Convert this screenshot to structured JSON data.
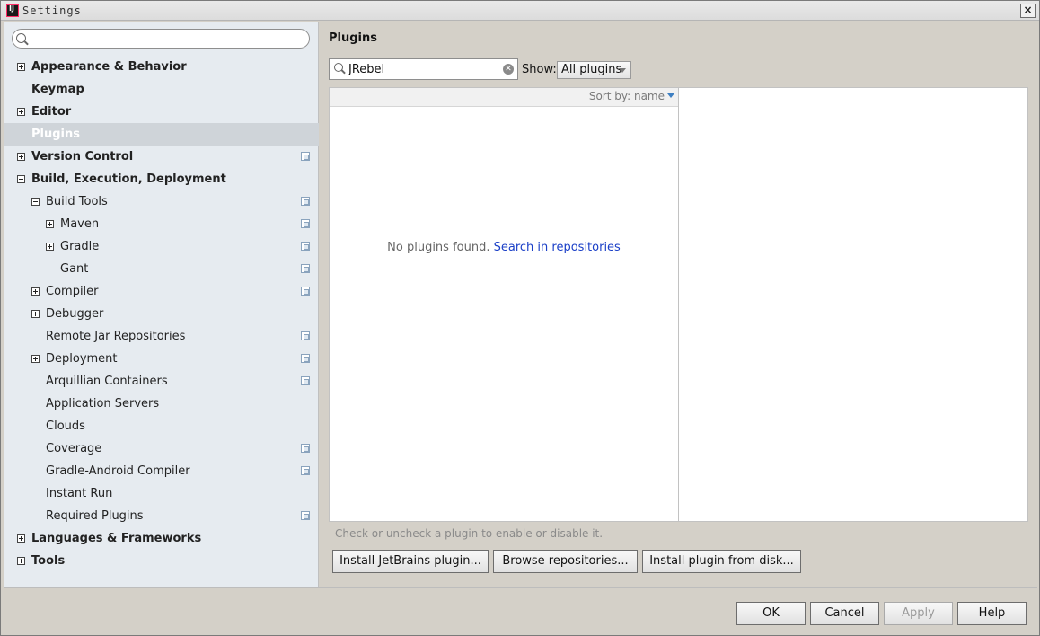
{
  "window": {
    "title": "Settings",
    "close_glyph": "×"
  },
  "sidebar": {
    "search_placeholder": "",
    "tree": [
      {
        "label": "Appearance & Behavior",
        "level": 0,
        "expander": "plus",
        "bold": true,
        "project_icon": false
      },
      {
        "label": "Keymap",
        "level": 0,
        "expander": "none",
        "bold": true,
        "project_icon": false
      },
      {
        "label": "Editor",
        "level": 0,
        "expander": "plus",
        "bold": true,
        "project_icon": false
      },
      {
        "label": "Plugins",
        "level": 0,
        "expander": "none",
        "bold": true,
        "project_icon": false,
        "selected": true
      },
      {
        "label": "Version Control",
        "level": 0,
        "expander": "plus",
        "bold": true,
        "project_icon": true
      },
      {
        "label": "Build, Execution, Deployment",
        "level": 0,
        "expander": "minus",
        "bold": true,
        "project_icon": false
      },
      {
        "label": "Build Tools",
        "level": 1,
        "expander": "minus",
        "bold": false,
        "project_icon": true
      },
      {
        "label": "Maven",
        "level": 2,
        "expander": "plus",
        "bold": false,
        "project_icon": true
      },
      {
        "label": "Gradle",
        "level": 2,
        "expander": "plus",
        "bold": false,
        "project_icon": true
      },
      {
        "label": "Gant",
        "level": 2,
        "expander": "none",
        "bold": false,
        "project_icon": true
      },
      {
        "label": "Compiler",
        "level": 1,
        "expander": "plus",
        "bold": false,
        "project_icon": true
      },
      {
        "label": "Debugger",
        "level": 1,
        "expander": "plus",
        "bold": false,
        "project_icon": false
      },
      {
        "label": "Remote Jar Repositories",
        "level": 1,
        "expander": "none",
        "bold": false,
        "project_icon": true
      },
      {
        "label": "Deployment",
        "level": 1,
        "expander": "plus",
        "bold": false,
        "project_icon": true
      },
      {
        "label": "Arquillian Containers",
        "level": 1,
        "expander": "none",
        "bold": false,
        "project_icon": true
      },
      {
        "label": "Application Servers",
        "level": 1,
        "expander": "none",
        "bold": false,
        "project_icon": false
      },
      {
        "label": "Clouds",
        "level": 1,
        "expander": "none",
        "bold": false,
        "project_icon": false
      },
      {
        "label": "Coverage",
        "level": 1,
        "expander": "none",
        "bold": false,
        "project_icon": true
      },
      {
        "label": "Gradle-Android Compiler",
        "level": 1,
        "expander": "none",
        "bold": false,
        "project_icon": true
      },
      {
        "label": "Instant Run",
        "level": 1,
        "expander": "none",
        "bold": false,
        "project_icon": false
      },
      {
        "label": "Required Plugins",
        "level": 1,
        "expander": "none",
        "bold": false,
        "project_icon": true
      },
      {
        "label": "Languages & Frameworks",
        "level": 0,
        "expander": "plus",
        "bold": true,
        "project_icon": false
      },
      {
        "label": "Tools",
        "level": 0,
        "expander": "plus",
        "bold": true,
        "project_icon": false
      }
    ]
  },
  "main": {
    "title": "Plugins",
    "search_value": "JRebel",
    "show_label": "Show:",
    "show_selected": "All plugins",
    "sort_label": "Sort by: name",
    "empty_text": "No plugins found.",
    "empty_link": "Search in repositories",
    "hint": "Check or uncheck a plugin to enable or disable it.",
    "buttons": {
      "install_jetbrains": "Install JetBrains plugin...",
      "browse_repos": "Browse repositories...",
      "install_disk": "Install plugin from disk..."
    }
  },
  "footer": {
    "ok": "OK",
    "cancel": "Cancel",
    "apply": "Apply",
    "help": "Help"
  },
  "colors": {
    "dialog_bg": "#d4d0c8",
    "sidebar_bg": "#e6ebf0",
    "selected_row": "#cfd4d9",
    "link": "#1a3fc7"
  }
}
